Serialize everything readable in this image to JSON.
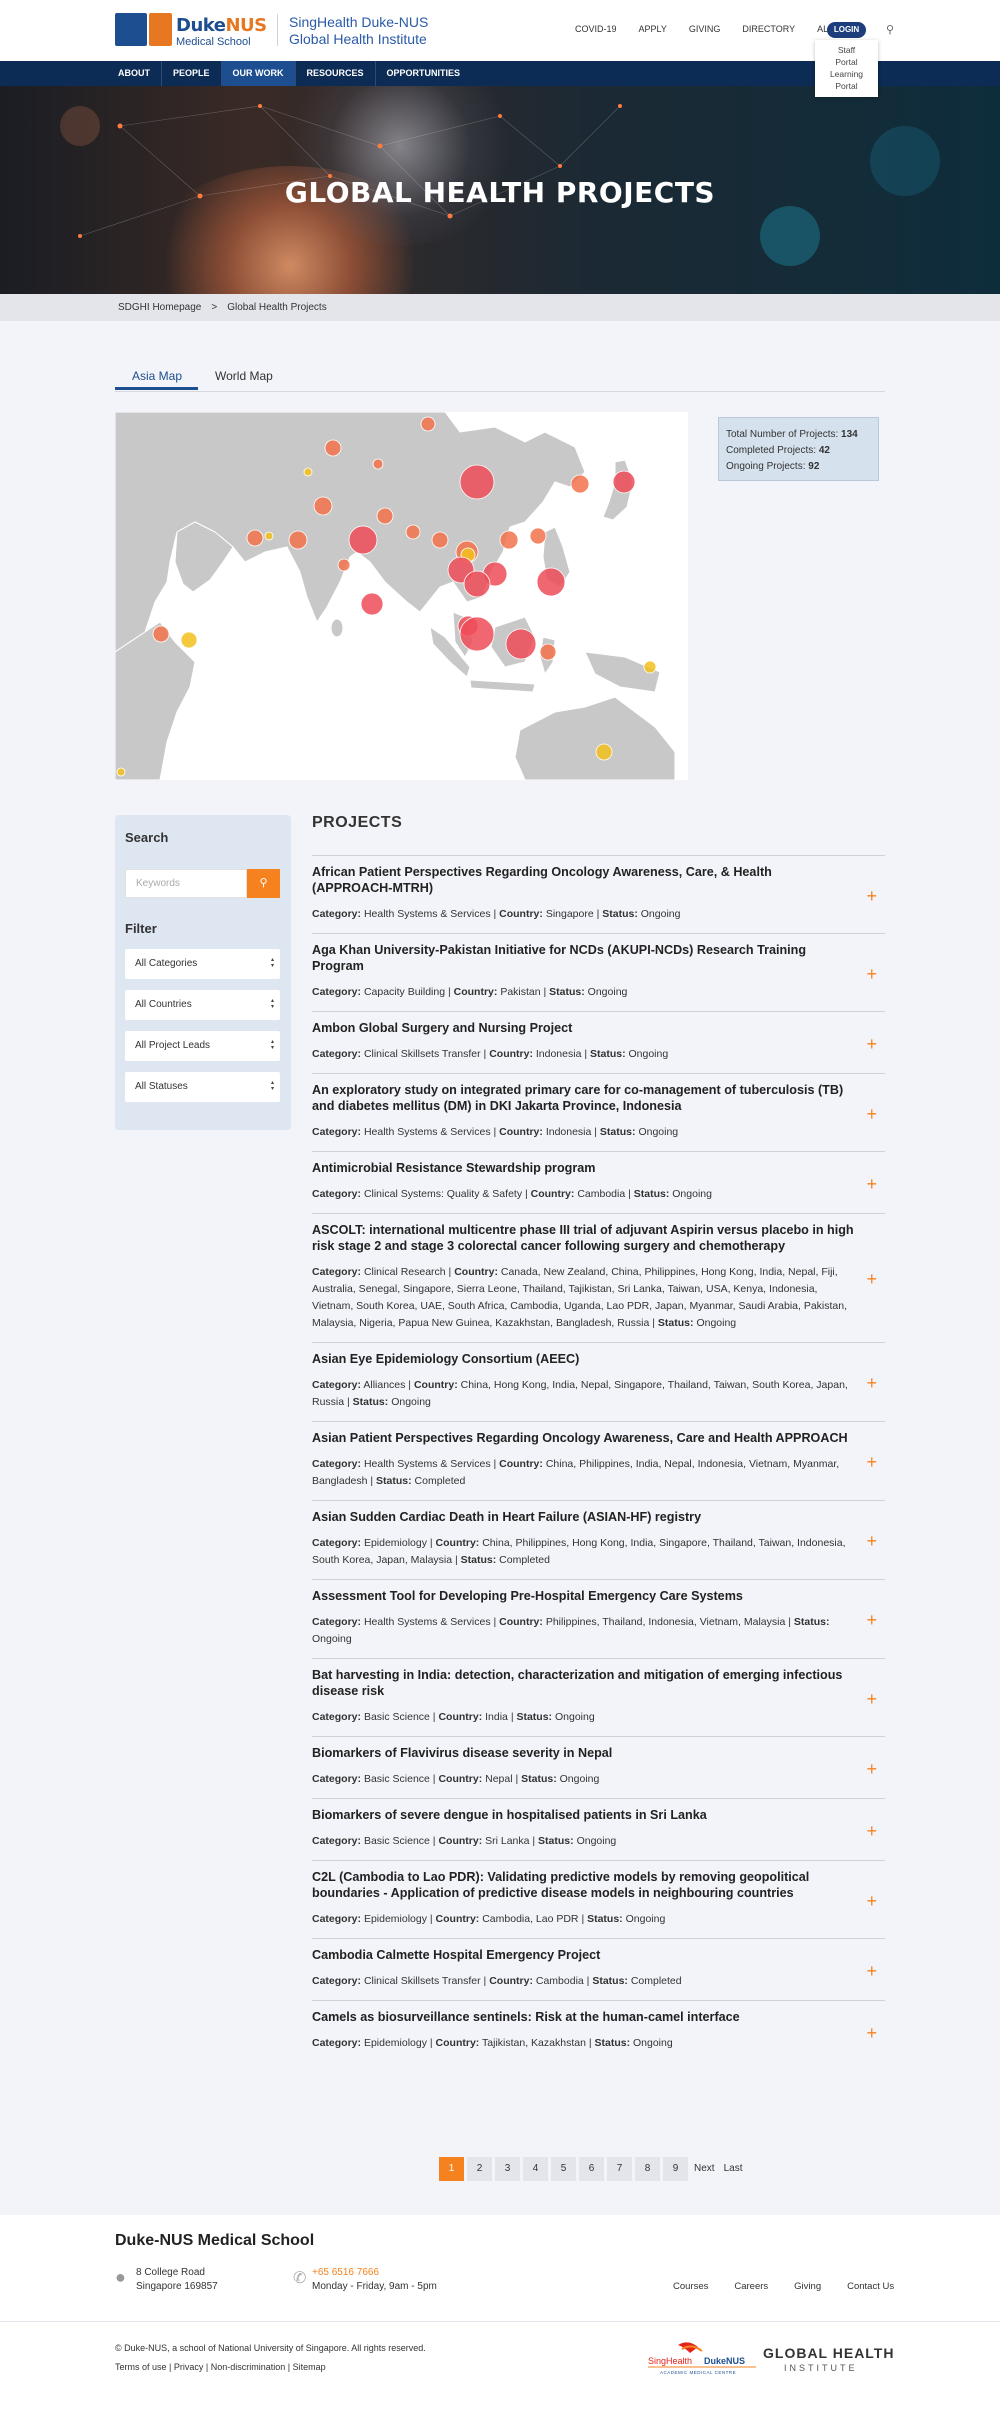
{
  "header": {
    "brand": {
      "duke": "Duke",
      "nus": "NUS",
      "sub": "Medical School"
    },
    "institute_line1": "SingHealth Duke-NUS",
    "institute_line2": "Global Health Institute",
    "top_nav": [
      "COVID-19",
      "APPLY",
      "GIVING",
      "DIRECTORY",
      "ALUMNI"
    ],
    "login": "LOGIN",
    "login_menu": [
      "Staff Portal",
      "Learning Portal"
    ],
    "search_icon": "search-icon"
  },
  "main_nav": [
    "ABOUT",
    "PEOPLE",
    "OUR WORK",
    "RESOURCES",
    "OPPORTUNITIES"
  ],
  "main_nav_active": "OUR WORK",
  "hero": {
    "title": "GLOBAL HEALTH PROJECTS"
  },
  "breadcrumb": {
    "home": "SDGHI Homepage",
    "separator": ">",
    "current": "Global Health Projects"
  },
  "map_tabs": {
    "tab1": "Asia Map",
    "tab2": "World Map",
    "active": "Asia Map"
  },
  "stats": {
    "total_label": "Total Number of Projects:",
    "total": "134",
    "completed_label": "Completed Projects:",
    "completed": "42",
    "ongoing_label": "Ongoing Projects:",
    "ongoing": "92"
  },
  "sidebar": {
    "search_heading": "Search",
    "keywords_placeholder": "Keywords",
    "filter_heading": "Filter",
    "filters": [
      "All Categories",
      "All Countries",
      "All Project Leads",
      "All Statuses"
    ]
  },
  "projects_heading": "PROJECTS",
  "labels": {
    "category": "Category:",
    "country": "Country:",
    "status": "Status:"
  },
  "projects": [
    {
      "title": "African Patient Perspectives Regarding Oncology Awareness, Care, & Health (APPROACH-MTRH)",
      "category": "Health Systems & Services",
      "country": "Singapore",
      "status": "Ongoing"
    },
    {
      "title": "Aga Khan University-Pakistan Initiative for NCDs (AKUPI-NCDs) Research Training Program",
      "category": "Capacity Building",
      "country": "Pakistan",
      "status": "Ongoing"
    },
    {
      "title": "Ambon Global Surgery and Nursing Project",
      "category": "Clinical Skillsets Transfer",
      "country": "Indonesia",
      "status": "Ongoing"
    },
    {
      "title": "An exploratory study on integrated primary care for co-management of tuberculosis (TB) and diabetes mellitus (DM) in DKI Jakarta Province, Indonesia",
      "category": "Health Systems & Services",
      "country": "Indonesia",
      "status": "Ongoing"
    },
    {
      "title": "Antimicrobial Resistance Stewardship program",
      "category": "Clinical Systems: Quality & Safety",
      "country": "Cambodia",
      "status": "Ongoing"
    },
    {
      "title": "ASCOLT: international multicentre phase III trial of adjuvant Aspirin versus placebo in high risk stage 2 and stage 3 colorectal cancer following surgery and chemotherapy",
      "category": "Clinical Research",
      "country": "Canada, New Zealand, China, Philippines, Hong Kong, India, Nepal, Fiji, Australia, Senegal, Singapore, Sierra Leone, Thailand, Tajikistan, Sri Lanka, Taiwan, USA, Kenya, Indonesia, Vietnam, South Korea, UAE, South Africa, Cambodia, Uganda, Lao PDR, Japan, Myanmar, Saudi Arabia, Pakistan, Malaysia, Nigeria, Papua New Guinea, Kazakhstan, Bangladesh, Russia",
      "status": "Ongoing"
    },
    {
      "title": "Asian Eye Epidemiology Consortium (AEEC)",
      "category": "Alliances",
      "country": "China, Hong Kong, India, Nepal, Singapore, Thailand, Taiwan, South Korea, Japan, Russia",
      "status": "Ongoing"
    },
    {
      "title": "Asian Patient Perspectives Regarding Oncology Awareness, Care and Health APPROACH",
      "category": "Health Systems & Services",
      "country": "China, Philippines, India, Nepal, Indonesia, Vietnam, Myanmar, Bangladesh",
      "status": "Completed"
    },
    {
      "title": "Asian Sudden Cardiac Death in Heart Failure (ASIAN-HF) registry",
      "category": "Epidemiology",
      "country": "China, Philippines, Hong Kong, India, Singapore, Thailand, Taiwan, Indonesia, South Korea, Japan, Malaysia",
      "status": "Completed"
    },
    {
      "title": "Assessment Tool for Developing Pre-Hospital Emergency Care Systems",
      "category": "Health Systems & Services",
      "country": "Philippines, Thailand, Indonesia, Vietnam, Malaysia",
      "status": "Ongoing"
    },
    {
      "title": "Bat harvesting in India: detection, characterization and mitigation of emerging infectious disease risk",
      "category": "Basic Science",
      "country": "India",
      "status": "Ongoing"
    },
    {
      "title": "Biomarkers of Flavivirus disease severity in Nepal",
      "category": "Basic Science",
      "country": "Nepal",
      "status": "Ongoing"
    },
    {
      "title": "Biomarkers of severe dengue in hospitalised patients in Sri Lanka",
      "category": "Basic Science",
      "country": "Sri Lanka",
      "status": "Ongoing"
    },
    {
      "title": "C2L (Cambodia to Lao PDR): Validating predictive models by removing geopolitical boundaries - Application of predictive disease models in neighbouring countries",
      "category": "Epidemiology",
      "country": "Cambodia, Lao PDR",
      "status": "Ongoing"
    },
    {
      "title": "Cambodia Calmette Hospital Emergency Project",
      "category": "Clinical Skillsets Transfer",
      "country": "Cambodia",
      "status": "Completed"
    },
    {
      "title": "Camels as biosurveillance sentinels: Risk at the human-camel interface",
      "category": "Epidemiology",
      "country": "Tajikistan, Kazakhstan",
      "status": "Ongoing"
    }
  ],
  "pagination": [
    "1",
    "2",
    "3",
    "4",
    "5",
    "6",
    "7",
    "8",
    "9",
    "Next",
    "Last"
  ],
  "pagination_active": "1",
  "footer": {
    "title": "Duke-NUS Medical School",
    "address1": "8 College Road",
    "address2": "Singapore 169857",
    "phone": "+65 6516 7666",
    "hours": "Monday - Friday, 9am - 5pm",
    "links": [
      "Courses",
      "Careers",
      "Giving",
      "Contact Us"
    ],
    "copyright": "© Duke-NUS, a school of National University of Singapore. All rights reserved.",
    "legal": "Terms of use | Privacy | Non-discrimination | Sitemap",
    "partner_singhealth": "SingHealth",
    "partner_dukenus": "DukeNUS",
    "partner_amc": "ACADEMIC MEDICAL CENTRE",
    "gh_title": "GLOBAL HEALTH",
    "gh_sub": "INSTITUTE"
  },
  "colors": {
    "brand_blue": "#1d4e8f",
    "navy": "#0c2c55",
    "accent_orange": "#f5821f",
    "marker_red": "#ee4c58",
    "marker_orange": "#f2724a",
    "marker_yellow": "#f3c01c"
  }
}
